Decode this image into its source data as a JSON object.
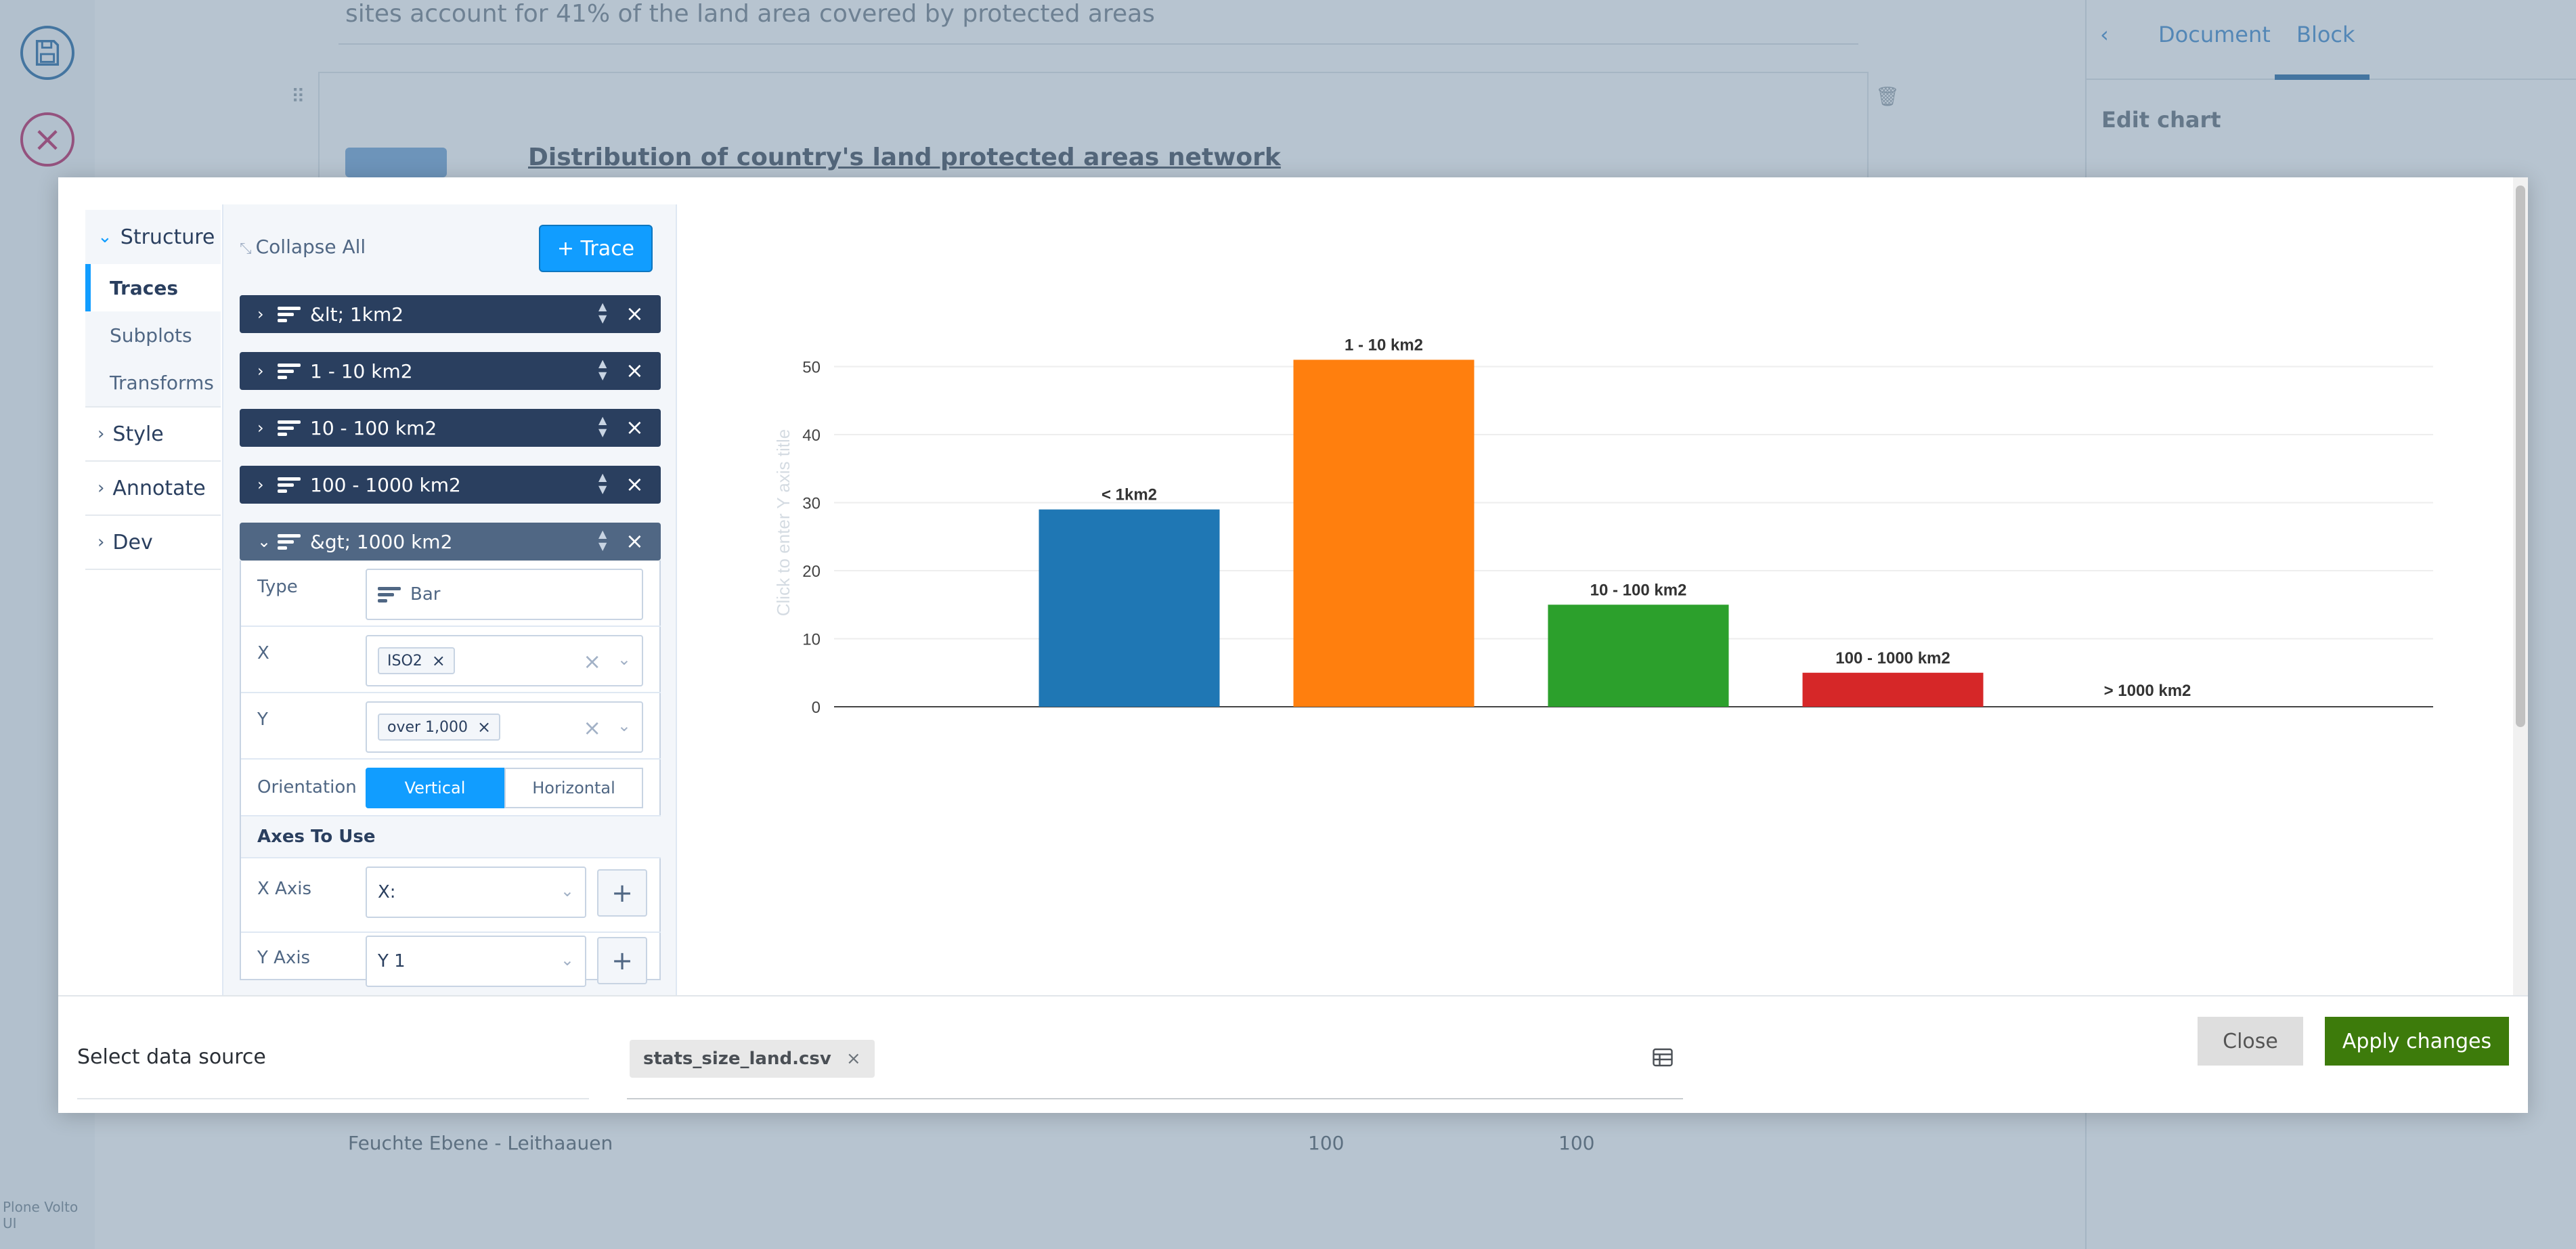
{
  "background": {
    "top_text": "sites account for 41% of the land area covered by protected areas",
    "chart_title": "Distribution of country's land protected areas network",
    "right_tabs": [
      "Document",
      "Block"
    ],
    "edit_chart": "Edit chart",
    "row": {
      "name": "Feuchte Ebene - Leithaauen",
      "v1": "100",
      "v2": "100"
    },
    "logo": "Plone Volto UI"
  },
  "nav": {
    "structure": "Structure",
    "items": [
      "Traces",
      "Subplots",
      "Transforms"
    ],
    "groups": [
      "Style",
      "Annotate",
      "Dev"
    ]
  },
  "panel": {
    "collapse_all": "Collapse All",
    "trace_button": "+ Trace",
    "traces": [
      "&lt; 1km2",
      "1 - 10 km2",
      "10 - 100 km2",
      "100 - 1000 km2",
      "&gt; 1000 km2"
    ],
    "type_label": "Type",
    "type_value": "Bar",
    "x_label": "X",
    "x_chip": "ISO2",
    "y_label": "Y",
    "y_chip": "over 1,000",
    "orientation_label": "Orientation",
    "orientation_options": [
      "Vertical",
      "Horizontal"
    ],
    "axes_section": "Axes To Use",
    "x_axis_label": "X Axis",
    "x_axis_value": "X:",
    "y_axis_label": "Y Axis",
    "y_axis_value": "Y 1"
  },
  "chart_data": {
    "type": "bar",
    "categories": [
      "< 1km2",
      "1 - 10 km2",
      "10 - 100 km2",
      "100 - 1000 km2",
      "> 1000 km2"
    ],
    "values": [
      29,
      51,
      15,
      5,
      0
    ],
    "data_labels": [
      "< 1km2",
      "1 - 10 km2",
      "10 - 100 km2",
      "100 - 1000 km2",
      "> 1000 km2"
    ],
    "colors": [
      "#1f77b4",
      "#ff7f0e",
      "#2ca02c",
      "#d62728",
      "#9467bd"
    ],
    "ylabel": "Click to enter Y axis title",
    "yticks": [
      0,
      10,
      20,
      30,
      40,
      50
    ],
    "ylim": [
      0,
      53.7
    ],
    "grid": true
  },
  "footer": {
    "select_source": "Select data source",
    "file": "stats_size_land.csv",
    "close": "Close",
    "apply": "Apply changes"
  }
}
